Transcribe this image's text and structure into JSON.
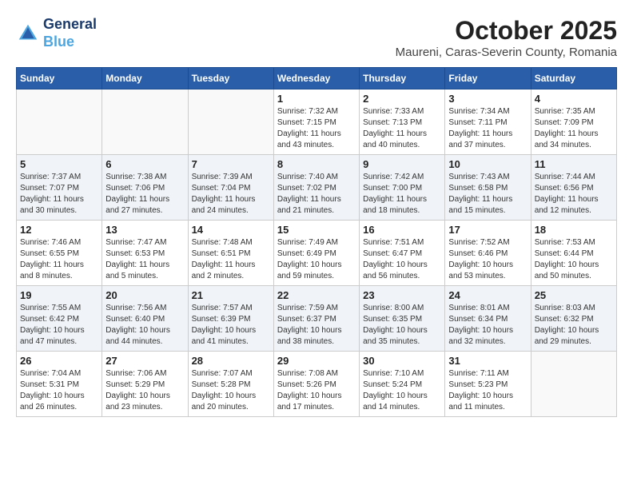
{
  "header": {
    "logo_line1": "General",
    "logo_line2": "Blue",
    "month": "October 2025",
    "location": "Maureni, Caras-Severin County, Romania"
  },
  "weekdays": [
    "Sunday",
    "Monday",
    "Tuesday",
    "Wednesday",
    "Thursday",
    "Friday",
    "Saturday"
  ],
  "weeks": [
    [
      {
        "day": "",
        "info": ""
      },
      {
        "day": "",
        "info": ""
      },
      {
        "day": "",
        "info": ""
      },
      {
        "day": "1",
        "info": "Sunrise: 7:32 AM\nSunset: 7:15 PM\nDaylight: 11 hours\nand 43 minutes."
      },
      {
        "day": "2",
        "info": "Sunrise: 7:33 AM\nSunset: 7:13 PM\nDaylight: 11 hours\nand 40 minutes."
      },
      {
        "day": "3",
        "info": "Sunrise: 7:34 AM\nSunset: 7:11 PM\nDaylight: 11 hours\nand 37 minutes."
      },
      {
        "day": "4",
        "info": "Sunrise: 7:35 AM\nSunset: 7:09 PM\nDaylight: 11 hours\nand 34 minutes."
      }
    ],
    [
      {
        "day": "5",
        "info": "Sunrise: 7:37 AM\nSunset: 7:07 PM\nDaylight: 11 hours\nand 30 minutes."
      },
      {
        "day": "6",
        "info": "Sunrise: 7:38 AM\nSunset: 7:06 PM\nDaylight: 11 hours\nand 27 minutes."
      },
      {
        "day": "7",
        "info": "Sunrise: 7:39 AM\nSunset: 7:04 PM\nDaylight: 11 hours\nand 24 minutes."
      },
      {
        "day": "8",
        "info": "Sunrise: 7:40 AM\nSunset: 7:02 PM\nDaylight: 11 hours\nand 21 minutes."
      },
      {
        "day": "9",
        "info": "Sunrise: 7:42 AM\nSunset: 7:00 PM\nDaylight: 11 hours\nand 18 minutes."
      },
      {
        "day": "10",
        "info": "Sunrise: 7:43 AM\nSunset: 6:58 PM\nDaylight: 11 hours\nand 15 minutes."
      },
      {
        "day": "11",
        "info": "Sunrise: 7:44 AM\nSunset: 6:56 PM\nDaylight: 11 hours\nand 12 minutes."
      }
    ],
    [
      {
        "day": "12",
        "info": "Sunrise: 7:46 AM\nSunset: 6:55 PM\nDaylight: 11 hours\nand 8 minutes."
      },
      {
        "day": "13",
        "info": "Sunrise: 7:47 AM\nSunset: 6:53 PM\nDaylight: 11 hours\nand 5 minutes."
      },
      {
        "day": "14",
        "info": "Sunrise: 7:48 AM\nSunset: 6:51 PM\nDaylight: 11 hours\nand 2 minutes."
      },
      {
        "day": "15",
        "info": "Sunrise: 7:49 AM\nSunset: 6:49 PM\nDaylight: 10 hours\nand 59 minutes."
      },
      {
        "day": "16",
        "info": "Sunrise: 7:51 AM\nSunset: 6:47 PM\nDaylight: 10 hours\nand 56 minutes."
      },
      {
        "day": "17",
        "info": "Sunrise: 7:52 AM\nSunset: 6:46 PM\nDaylight: 10 hours\nand 53 minutes."
      },
      {
        "day": "18",
        "info": "Sunrise: 7:53 AM\nSunset: 6:44 PM\nDaylight: 10 hours\nand 50 minutes."
      }
    ],
    [
      {
        "day": "19",
        "info": "Sunrise: 7:55 AM\nSunset: 6:42 PM\nDaylight: 10 hours\nand 47 minutes."
      },
      {
        "day": "20",
        "info": "Sunrise: 7:56 AM\nSunset: 6:40 PM\nDaylight: 10 hours\nand 44 minutes."
      },
      {
        "day": "21",
        "info": "Sunrise: 7:57 AM\nSunset: 6:39 PM\nDaylight: 10 hours\nand 41 minutes."
      },
      {
        "day": "22",
        "info": "Sunrise: 7:59 AM\nSunset: 6:37 PM\nDaylight: 10 hours\nand 38 minutes."
      },
      {
        "day": "23",
        "info": "Sunrise: 8:00 AM\nSunset: 6:35 PM\nDaylight: 10 hours\nand 35 minutes."
      },
      {
        "day": "24",
        "info": "Sunrise: 8:01 AM\nSunset: 6:34 PM\nDaylight: 10 hours\nand 32 minutes."
      },
      {
        "day": "25",
        "info": "Sunrise: 8:03 AM\nSunset: 6:32 PM\nDaylight: 10 hours\nand 29 minutes."
      }
    ],
    [
      {
        "day": "26",
        "info": "Sunrise: 7:04 AM\nSunset: 5:31 PM\nDaylight: 10 hours\nand 26 minutes."
      },
      {
        "day": "27",
        "info": "Sunrise: 7:06 AM\nSunset: 5:29 PM\nDaylight: 10 hours\nand 23 minutes."
      },
      {
        "day": "28",
        "info": "Sunrise: 7:07 AM\nSunset: 5:28 PM\nDaylight: 10 hours\nand 20 minutes."
      },
      {
        "day": "29",
        "info": "Sunrise: 7:08 AM\nSunset: 5:26 PM\nDaylight: 10 hours\nand 17 minutes."
      },
      {
        "day": "30",
        "info": "Sunrise: 7:10 AM\nSunset: 5:24 PM\nDaylight: 10 hours\nand 14 minutes."
      },
      {
        "day": "31",
        "info": "Sunrise: 7:11 AM\nSunset: 5:23 PM\nDaylight: 10 hours\nand 11 minutes."
      },
      {
        "day": "",
        "info": ""
      }
    ]
  ]
}
